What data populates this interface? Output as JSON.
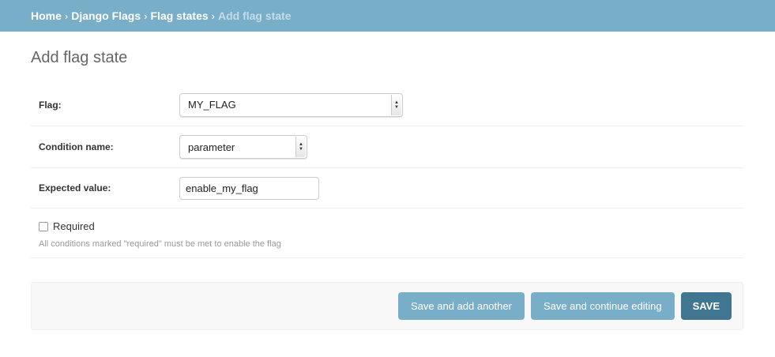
{
  "breadcrumbs": {
    "home": "Home",
    "app": "Django Flags",
    "model": "Flag states",
    "current": "Add flag state",
    "separator": "›"
  },
  "page": {
    "title": "Add flag state"
  },
  "form": {
    "flag": {
      "label": "Flag:",
      "value": "MY_FLAG"
    },
    "condition": {
      "label": "Condition name:",
      "value": "parameter"
    },
    "expected": {
      "label": "Expected value:",
      "value": "enable_my_flag"
    },
    "required": {
      "label": "Required",
      "checked": false,
      "help": "All conditions marked \"required\" must be met to enable the flag"
    }
  },
  "actions": {
    "save_add_another": "Save and add another",
    "save_continue": "Save and continue editing",
    "save": "SAVE"
  },
  "colors": {
    "header": "#79aec8",
    "button": "#79aec8",
    "save_button": "#417690"
  }
}
